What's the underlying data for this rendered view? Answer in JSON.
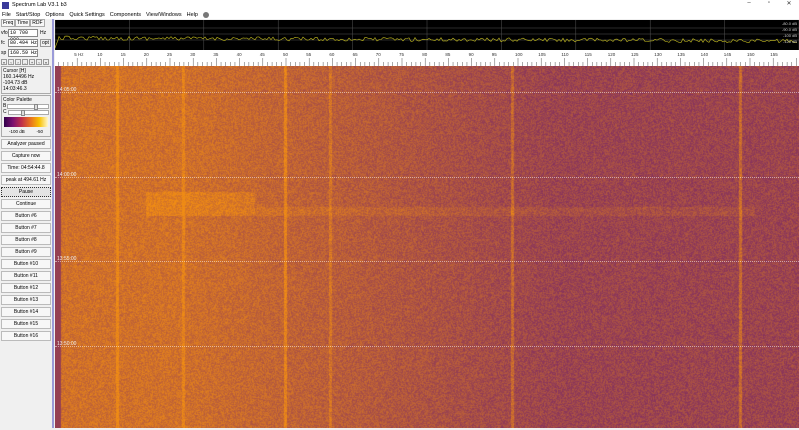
{
  "window": {
    "title": "Spectrum Lab V3.1 b3",
    "minimize": "–",
    "maximize": "▫",
    "close": "✕"
  },
  "menu": [
    "File",
    "Start/Stop",
    "Options",
    "Quick Settings",
    "Components",
    "View/Windows",
    "Help"
  ],
  "tabs": [
    "Freq",
    "Time",
    "RDF"
  ],
  "fields": {
    "vfo_label": "vfo",
    "vfo": "10 700 000",
    "vfo_unit": "Hz",
    "fc_label": "fc",
    "fc": "80.494 Hz",
    "opt": "opt",
    "sp_label": "sp",
    "sp": "160.59 Hz"
  },
  "nav_arrows": [
    "«",
    "‹",
    "›",
    "-",
    "+",
    "‹",
    "»"
  ],
  "cursor": {
    "title": "Cursor [H]",
    "freq": "160.14496 Hz",
    "level": "-104.73 dB",
    "time": "14:03:46.3"
  },
  "palette": {
    "title": "Color Palette",
    "b_label": "B",
    "c_label": "C",
    "b_value": 0.72,
    "c_value": 0.35,
    "min": "-100 dB",
    "max": "-50"
  },
  "buttons": [
    "Analyzer paused",
    "Capture now",
    "Time:  04:54:44.8",
    "peak at 494.61 Hz",
    "Pause",
    "Continue",
    "Button #6",
    "Button #7",
    "Button #8",
    "Button #9",
    "Button #10",
    "Button #11",
    "Button #12",
    "Button #13",
    "Button #14",
    "Button #15",
    "Button #16"
  ],
  "spectrum": {
    "db_labels": [
      "-80.0 dB",
      "-90.0 dB",
      "-100 dB",
      "-120 dB"
    ]
  },
  "freq_axis": {
    "labels": [
      "5 Hz",
      "10",
      "15",
      "20",
      "25",
      "30",
      "35",
      "40",
      "45",
      "50",
      "55",
      "60",
      "65",
      "70",
      "75",
      "80",
      "85",
      "90",
      "95",
      "100",
      "105",
      "110",
      "115",
      "120",
      "125",
      "130",
      "135",
      "140",
      "145",
      "150",
      "155"
    ],
    "values": [
      5,
      10,
      15,
      20,
      25,
      30,
      35,
      40,
      45,
      50,
      55,
      60,
      65,
      70,
      75,
      80,
      85,
      90,
      95,
      100,
      105,
      110,
      115,
      120,
      125,
      130,
      135,
      140,
      145,
      150,
      155
    ]
  },
  "waterfall": {
    "times": [
      "14:05:00",
      "14:00:00",
      "13:55:00",
      "13:50:00"
    ]
  }
}
